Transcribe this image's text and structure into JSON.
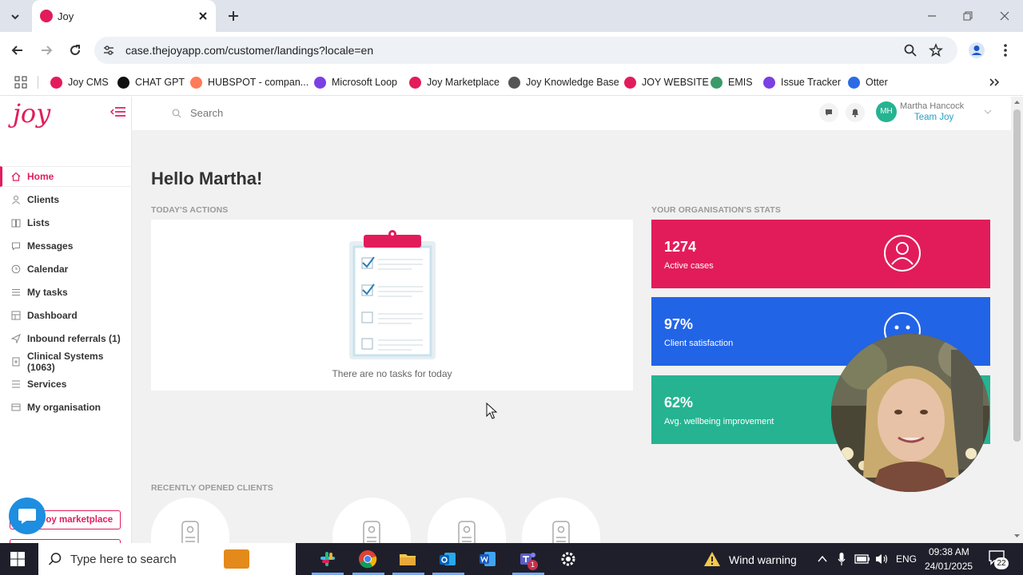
{
  "browser": {
    "tab_title": "Joy",
    "url": "case.thejoyapp.com/customer/landings?locale=en",
    "bookmarks": [
      {
        "label": "Joy CMS",
        "color": "#e21c5b"
      },
      {
        "label": "CHAT GPT",
        "color": "#111111"
      },
      {
        "label": "HUBSPOT - compan...",
        "color": "#ff7a59"
      },
      {
        "label": "Microsoft Loop",
        "color": "#7b3fe4"
      },
      {
        "label": "Joy Marketplace",
        "color": "#e21c5b"
      },
      {
        "label": "Joy Knowledge Base",
        "color": "#555555"
      },
      {
        "label": "JOY WEBSITE",
        "color": "#e21c5b"
      },
      {
        "label": "EMIS",
        "color": "#3a9a6a"
      },
      {
        "label": "Issue Tracker",
        "color": "#7b3fe4"
      },
      {
        "label": "Otter",
        "color": "#2b6ce4"
      }
    ]
  },
  "app": {
    "logo": "joy",
    "search_placeholder": "Search",
    "user": {
      "initials": "MH",
      "name": "Martha Hancock",
      "team": "Team Joy"
    },
    "nav": [
      {
        "label": "Home",
        "active": true
      },
      {
        "label": "Clients"
      },
      {
        "label": "Lists"
      },
      {
        "label": "Messages"
      },
      {
        "label": "Calendar"
      },
      {
        "label": "My tasks"
      },
      {
        "label": "Dashboard"
      },
      {
        "label": "Inbound referrals (1)"
      },
      {
        "label": "Clinical Systems (1063)"
      },
      {
        "label": "Services"
      },
      {
        "label": "My organisation"
      }
    ],
    "marketplace_button": "Joy marketplace",
    "greeting": "Hello Martha!",
    "todays_actions": {
      "title": "TODAY'S ACTIONS",
      "empty_text": "There are no tasks for today"
    },
    "stats_title": "YOUR ORGANISATION'S STATS",
    "stats": [
      {
        "value": "1274",
        "label": "Active cases",
        "color": "#e21c5b",
        "icon": "user-icon"
      },
      {
        "value": "97%",
        "label": "Client satisfaction",
        "color": "#2264e6",
        "icon": "smiley-icon"
      },
      {
        "value": "62%",
        "label": "Avg. wellbeing improvement",
        "color": "#26b391",
        "icon": "wellbeing-icon"
      }
    ],
    "recent_clients_title": "RECENTLY OPENED CLIENTS"
  },
  "taskbar": {
    "search_placeholder": "Type here to search",
    "weather": "Wind warning",
    "language": "ENG",
    "time": "09:38 AM",
    "date": "24/01/2025",
    "notifications": "22",
    "teams_badge": "1"
  }
}
